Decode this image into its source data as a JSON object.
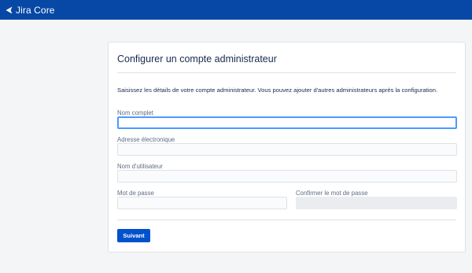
{
  "header": {
    "app_name": "Jira Core",
    "logo_icon": "jira-arrow-icon",
    "bg_color": "#0747a6"
  },
  "form": {
    "title": "Configurer un compte administrateur",
    "description": "Saisissez les détails de votre compte administrateur. Vous pouvez ajouter d'autres administrateurs après la configuration.",
    "full_name": {
      "label": "Nom complet",
      "value": ""
    },
    "email": {
      "label": "Adresse électronique",
      "value": ""
    },
    "username": {
      "label": "Nom d'utilisateur",
      "value": ""
    },
    "password": {
      "label": "Mot de passe",
      "value": ""
    },
    "confirm_password": {
      "label": "Confirmer le mot de passe",
      "value": ""
    },
    "submit_label": "Suivant",
    "accent_color": "#0052cc"
  }
}
